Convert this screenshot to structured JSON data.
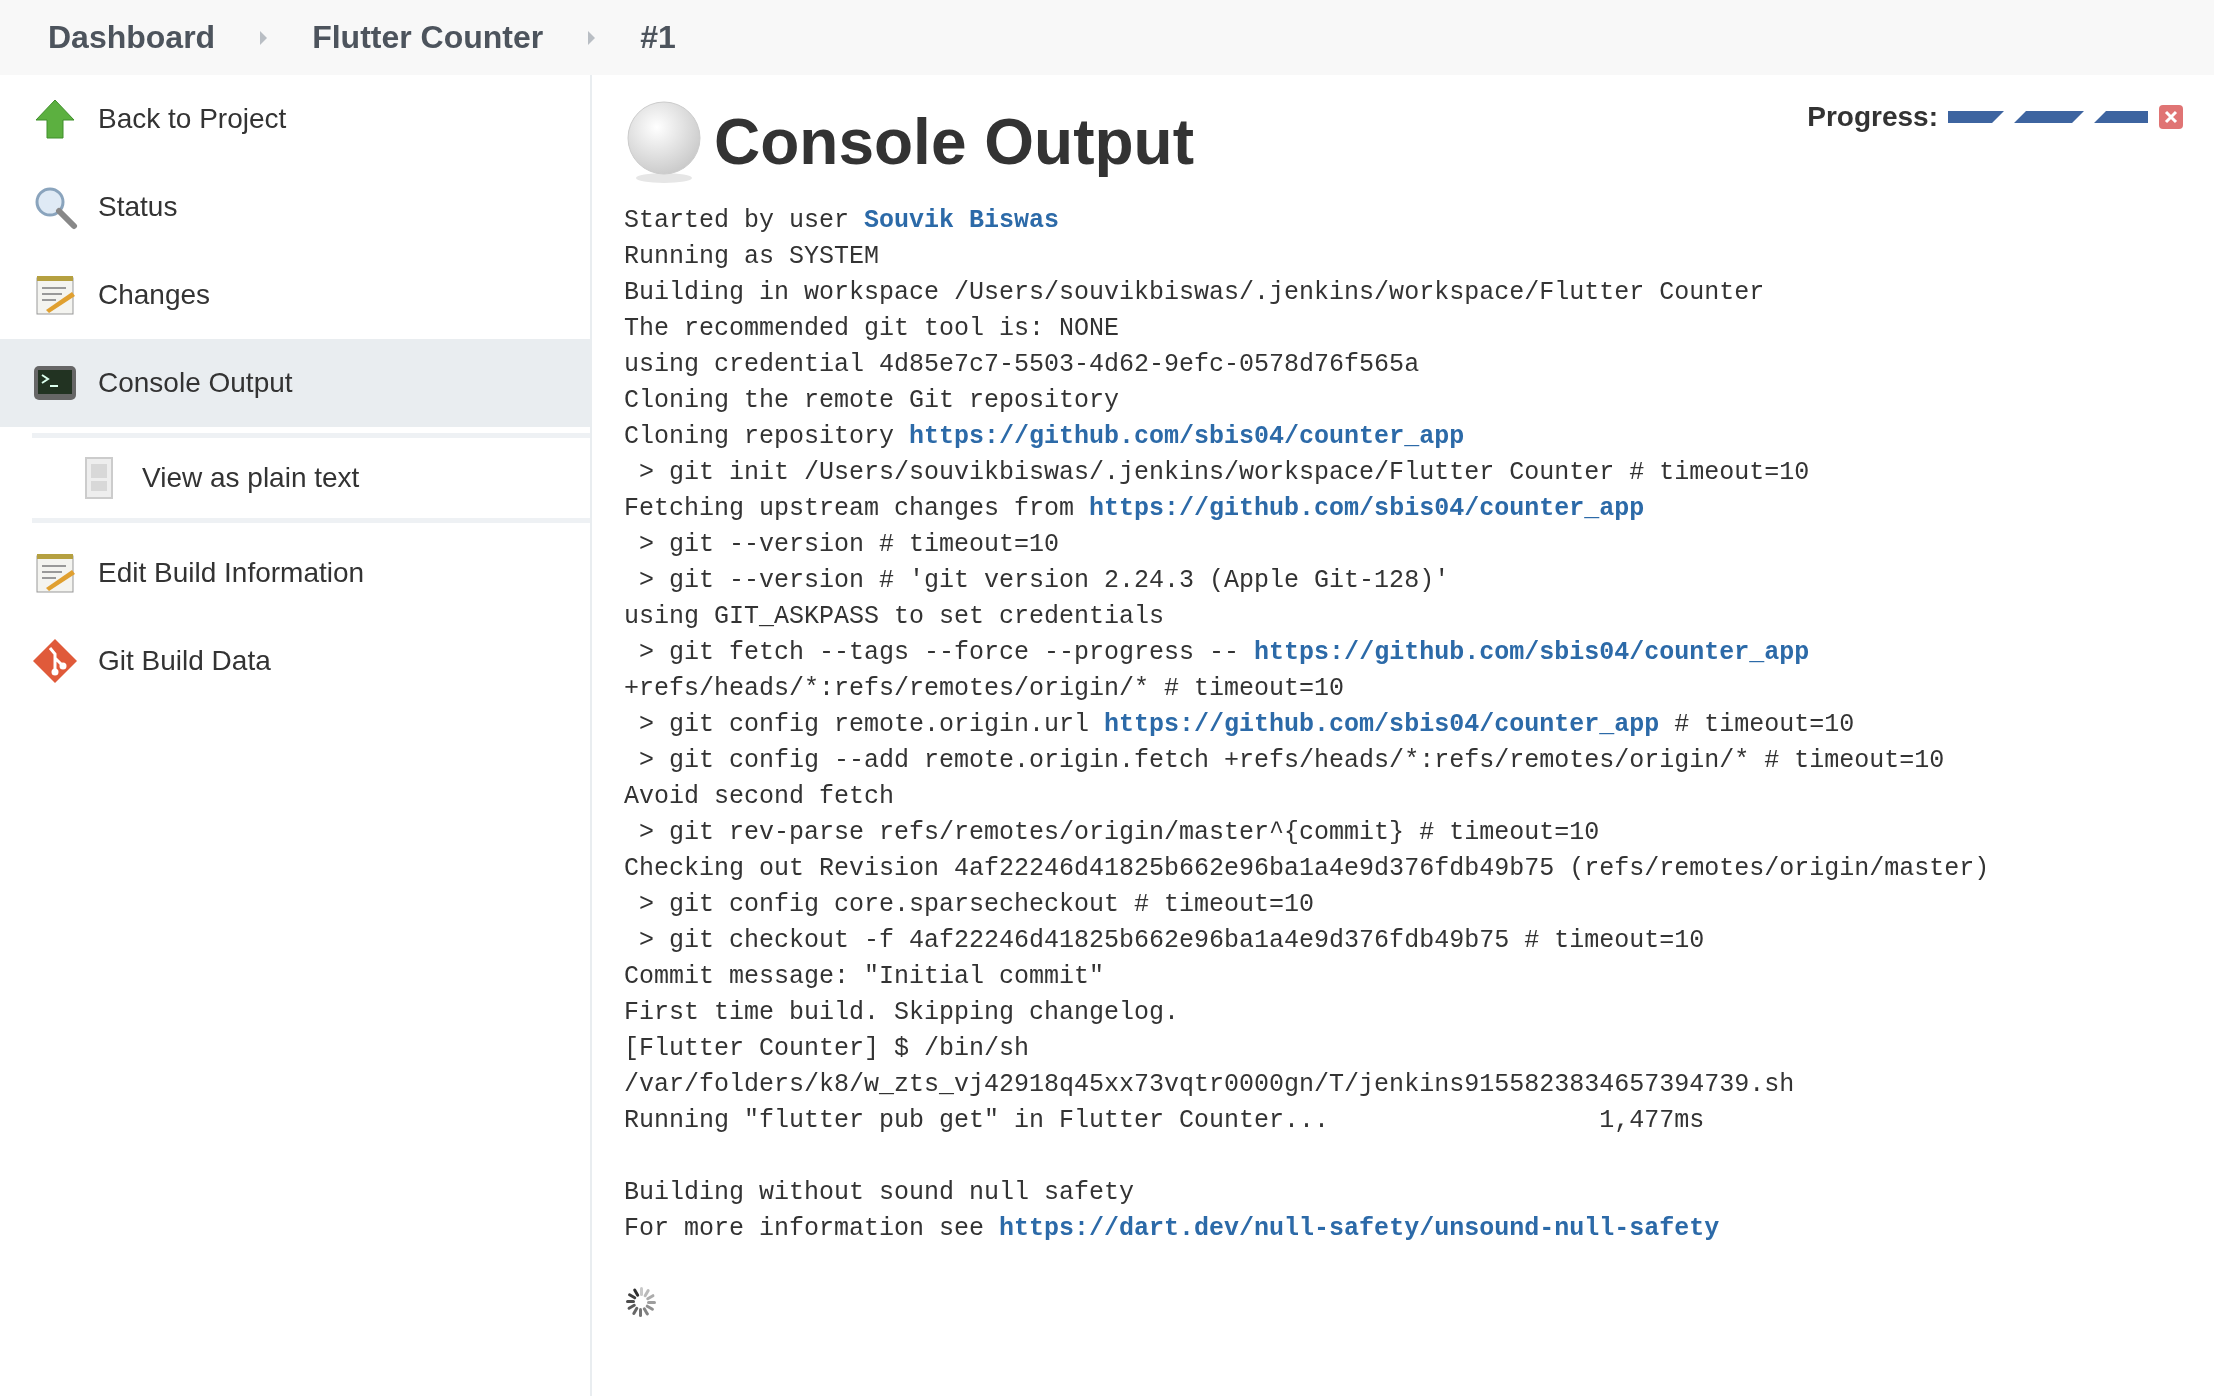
{
  "breadcrumbs": [
    {
      "label": "Dashboard"
    },
    {
      "label": "Flutter Counter"
    },
    {
      "label": "#1"
    }
  ],
  "sidebar": {
    "items": [
      {
        "label": "Back to Project",
        "selected": false
      },
      {
        "label": "Status",
        "selected": false
      },
      {
        "label": "Changes",
        "selected": false
      },
      {
        "label": "Console Output",
        "selected": true,
        "children": [
          {
            "label": "View as plain text",
            "selected": false
          }
        ]
      },
      {
        "label": "Edit Build Information",
        "selected": false
      },
      {
        "label": "Git Build Data",
        "selected": false
      }
    ]
  },
  "page": {
    "title": "Console Output",
    "progress_label": "Progress:",
    "progress": {
      "level": 1
    }
  },
  "console": {
    "lines": [
      {
        "kind": "text",
        "parts": [
          {
            "kind": "plain",
            "text": "Started by user "
          },
          {
            "kind": "link",
            "text": "Souvik Biswas"
          }
        ]
      },
      {
        "kind": "text",
        "parts": [
          {
            "kind": "plain",
            "text": "Running as SYSTEM"
          }
        ]
      },
      {
        "kind": "text",
        "parts": [
          {
            "kind": "plain",
            "text": "Building in workspace /Users/souvikbiswas/.jenkins/workspace/Flutter Counter"
          }
        ]
      },
      {
        "kind": "text",
        "parts": [
          {
            "kind": "plain",
            "text": "The recommended git tool is: NONE"
          }
        ]
      },
      {
        "kind": "text",
        "parts": [
          {
            "kind": "plain",
            "text": "using credential 4d85e7c7-5503-4d62-9efc-0578d76f565a"
          }
        ]
      },
      {
        "kind": "text",
        "parts": [
          {
            "kind": "plain",
            "text": "Cloning the remote Git repository"
          }
        ]
      },
      {
        "kind": "text",
        "parts": [
          {
            "kind": "plain",
            "text": "Cloning repository "
          },
          {
            "kind": "link",
            "text": "https://github.com/sbis04/counter_app"
          }
        ]
      },
      {
        "kind": "text",
        "parts": [
          {
            "kind": "plain",
            "text": " > git init /Users/souvikbiswas/.jenkins/workspace/Flutter Counter # timeout=10"
          }
        ]
      },
      {
        "kind": "text",
        "parts": [
          {
            "kind": "plain",
            "text": "Fetching upstream changes from "
          },
          {
            "kind": "link",
            "text": "https://github.com/sbis04/counter_app"
          }
        ]
      },
      {
        "kind": "text",
        "parts": [
          {
            "kind": "plain",
            "text": " > git --version # timeout=10"
          }
        ]
      },
      {
        "kind": "text",
        "parts": [
          {
            "kind": "plain",
            "text": " > git --version # 'git version 2.24.3 (Apple Git-128)'"
          }
        ]
      },
      {
        "kind": "text",
        "parts": [
          {
            "kind": "plain",
            "text": "using GIT_ASKPASS to set credentials"
          }
        ]
      },
      {
        "kind": "text",
        "parts": [
          {
            "kind": "plain",
            "text": " > git fetch --tags --force --progress -- "
          },
          {
            "kind": "link",
            "text": "https://github.com/sbis04/counter_app"
          }
        ]
      },
      {
        "kind": "text",
        "parts": [
          {
            "kind": "plain",
            "text": "+refs/heads/*:refs/remotes/origin/* # timeout=10"
          }
        ]
      },
      {
        "kind": "text",
        "parts": [
          {
            "kind": "plain",
            "text": " > git config remote.origin.url "
          },
          {
            "kind": "link",
            "text": "https://github.com/sbis04/counter_app"
          },
          {
            "kind": "plain",
            "text": " # timeout=10"
          }
        ]
      },
      {
        "kind": "text",
        "parts": [
          {
            "kind": "plain",
            "text": " > git config --add remote.origin.fetch +refs/heads/*:refs/remotes/origin/* # timeout=10"
          }
        ]
      },
      {
        "kind": "text",
        "parts": [
          {
            "kind": "plain",
            "text": "Avoid second fetch"
          }
        ]
      },
      {
        "kind": "text",
        "parts": [
          {
            "kind": "plain",
            "text": " > git rev-parse refs/remotes/origin/master^{commit} # timeout=10"
          }
        ]
      },
      {
        "kind": "text",
        "parts": [
          {
            "kind": "plain",
            "text": "Checking out Revision 4af22246d41825b662e96ba1a4e9d376fdb49b75 (refs/remotes/origin/master)"
          }
        ]
      },
      {
        "kind": "text",
        "parts": [
          {
            "kind": "plain",
            "text": " > git config core.sparsecheckout # timeout=10"
          }
        ]
      },
      {
        "kind": "text",
        "parts": [
          {
            "kind": "plain",
            "text": " > git checkout -f 4af22246d41825b662e96ba1a4e9d376fdb49b75 # timeout=10"
          }
        ]
      },
      {
        "kind": "text",
        "parts": [
          {
            "kind": "plain",
            "text": "Commit message: \"Initial commit\""
          }
        ]
      },
      {
        "kind": "text",
        "parts": [
          {
            "kind": "plain",
            "text": "First time build. Skipping changelog."
          }
        ]
      },
      {
        "kind": "text",
        "parts": [
          {
            "kind": "plain",
            "text": "[Flutter Counter] $ /bin/sh"
          }
        ]
      },
      {
        "kind": "text",
        "parts": [
          {
            "kind": "plain",
            "text": "/var/folders/k8/w_zts_vj42918q45xx73vqtr0000gn/T/jenkins9155823834657394739.sh"
          }
        ]
      },
      {
        "kind": "text",
        "parts": [
          {
            "kind": "plain",
            "text": "Running \"flutter pub get\" in Flutter Counter...                  1,477ms"
          }
        ]
      },
      {
        "kind": "blank"
      },
      {
        "kind": "text",
        "parts": [
          {
            "kind": "plain",
            "text": "Building without sound null safety"
          }
        ]
      },
      {
        "kind": "text",
        "parts": [
          {
            "kind": "plain",
            "text": "For more information see "
          },
          {
            "kind": "link",
            "text": "https://dart.dev/null-safety/unsound-null-safety"
          }
        ]
      }
    ]
  }
}
